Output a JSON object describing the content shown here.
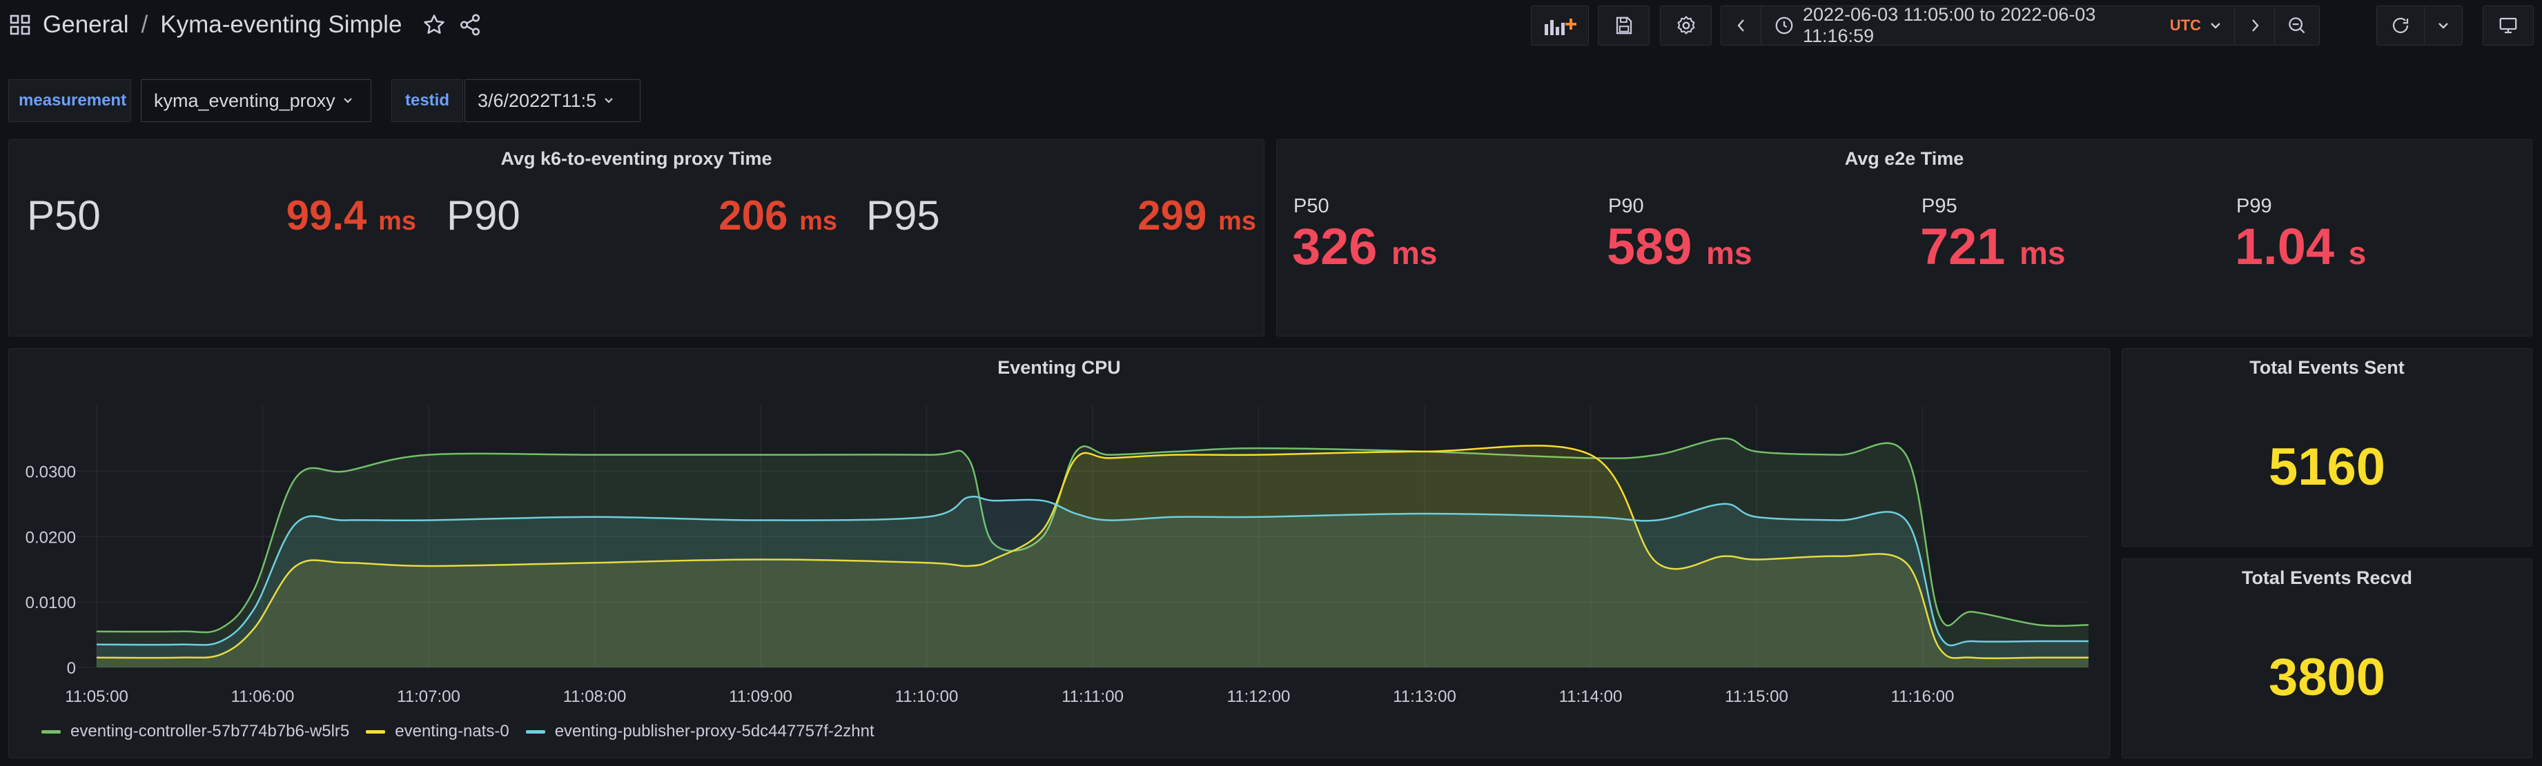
{
  "nav": {
    "folder": "General",
    "separator": "/",
    "dashboard_title": "Kyma-eventing Simple",
    "time_range": "2022-06-03 11:05:00 to 2022-06-03 11:16:59",
    "timezone": "UTC"
  },
  "variables": [
    {
      "label": "measurement",
      "value": "kyma_eventing_proxy"
    },
    {
      "label": "testid",
      "value": "3/6/2022T11:5"
    }
  ],
  "panels": {
    "proxy": {
      "title": "Avg k6-to-eventing proxy Time",
      "stats": [
        {
          "label": "P50",
          "value": "99.4",
          "unit": "ms"
        },
        {
          "label": "P90",
          "value": "206",
          "unit": "ms"
        },
        {
          "label": "P95",
          "value": "299",
          "unit": "ms"
        }
      ]
    },
    "e2e": {
      "title": "Avg e2e Time",
      "stats": [
        {
          "label": "P50",
          "value": "326",
          "unit": "ms"
        },
        {
          "label": "P90",
          "value": "589",
          "unit": "ms"
        },
        {
          "label": "P95",
          "value": "721",
          "unit": "ms"
        },
        {
          "label": "P99",
          "value": "1.04",
          "unit": "s"
        }
      ]
    },
    "sent": {
      "title": "Total Events Sent",
      "value": "5160"
    },
    "recvd": {
      "title": "Total Events Recvd",
      "value": "3800"
    },
    "cpu": {
      "title": "Eventing CPU"
    }
  },
  "colors": {
    "controller": "#73bf69",
    "nats": "#fade2a",
    "publisher": "#5794f2",
    "publisher_line": "#6ed0e0",
    "red": "#e0452f",
    "e2e_red": "#f2495c",
    "yellow": "#fade2a"
  },
  "chart_data": {
    "type": "line",
    "title": "Eventing CPU",
    "x_ticks": [
      "11:05:00",
      "11:06:00",
      "11:07:00",
      "11:08:00",
      "11:09:00",
      "11:10:00",
      "11:11:00",
      "11:12:00",
      "11:13:00",
      "11:14:00",
      "11:15:00",
      "11:16:00"
    ],
    "y_ticks": [
      "0",
      "0.0100",
      "0.0200",
      "0.0300"
    ],
    "ylim": [
      0,
      0.039
    ],
    "x_minutes": [
      0,
      0.5,
      0.75,
      0.95,
      1.2,
      1.5,
      2,
      3,
      4,
      5,
      5.25,
      5.4,
      5.7,
      5.9,
      6.1,
      6.5,
      7,
      8,
      9,
      9.4,
      9.8,
      10,
      10.5,
      10.9,
      11.1,
      11.3,
      11.7,
      12
    ],
    "series": [
      {
        "name": "eventing-controller-57b774b7b6-w5lr5",
        "values": [
          0.0055,
          0.0055,
          0.006,
          0.012,
          0.029,
          0.03,
          0.0325,
          0.0325,
          0.0325,
          0.0325,
          0.032,
          0.019,
          0.02,
          0.033,
          0.0325,
          0.033,
          0.0335,
          0.033,
          0.032,
          0.0325,
          0.035,
          0.033,
          0.0325,
          0.0325,
          0.008,
          0.0085,
          0.0065,
          0.0065
        ]
      },
      {
        "name": "eventing-nats-0",
        "values": [
          0.0015,
          0.0015,
          0.002,
          0.006,
          0.0155,
          0.016,
          0.0155,
          0.016,
          0.0165,
          0.016,
          0.0155,
          0.0165,
          0.021,
          0.032,
          0.032,
          0.0325,
          0.0325,
          0.033,
          0.0325,
          0.016,
          0.017,
          0.0165,
          0.017,
          0.016,
          0.003,
          0.0015,
          0.0015,
          0.0015
        ]
      },
      {
        "name": "eventing-publisher-proxy-5dc447757f-2zhnt",
        "values": [
          0.0035,
          0.0035,
          0.004,
          0.009,
          0.022,
          0.0225,
          0.0225,
          0.023,
          0.0225,
          0.023,
          0.026,
          0.0255,
          0.0255,
          0.0235,
          0.0225,
          0.023,
          0.023,
          0.0235,
          0.023,
          0.0225,
          0.025,
          0.023,
          0.0225,
          0.0225,
          0.005,
          0.004,
          0.004,
          0.004
        ]
      }
    ]
  }
}
